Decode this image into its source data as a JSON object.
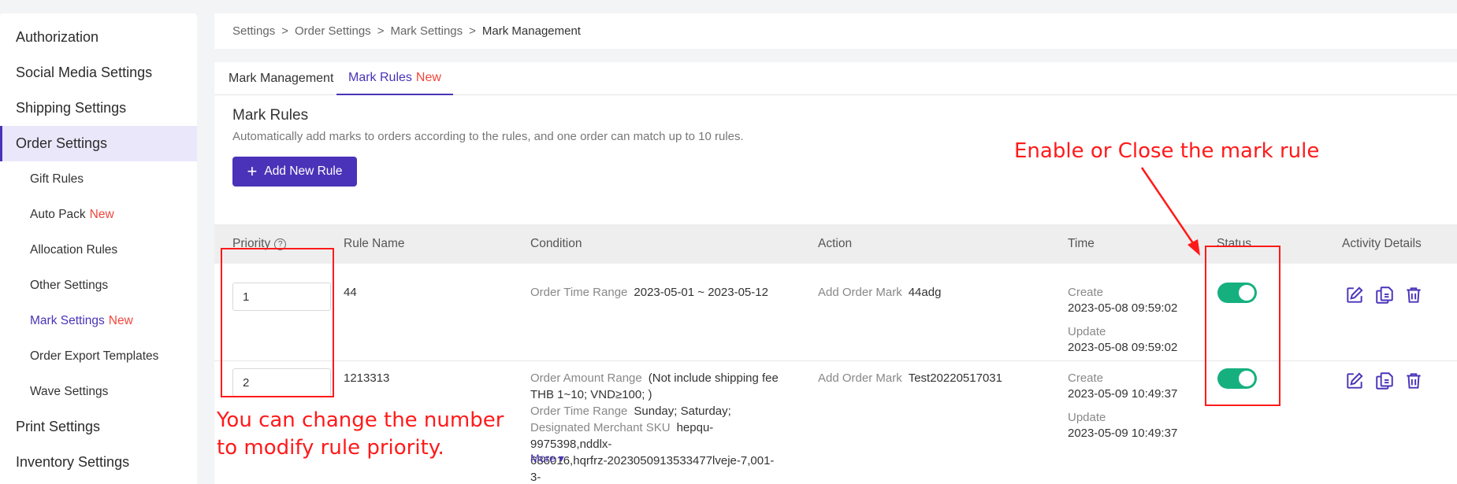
{
  "sidebar": {
    "items": [
      {
        "label": "Authorization"
      },
      {
        "label": "Social Media Settings"
      },
      {
        "label": "Shipping Settings"
      },
      {
        "label": "Order Settings"
      },
      {
        "label": "Gift Rules"
      },
      {
        "label": "Auto Pack",
        "tag": "New"
      },
      {
        "label": "Allocation Rules"
      },
      {
        "label": "Other Settings"
      },
      {
        "label": "Mark Settings",
        "tag": "New"
      },
      {
        "label": "Order Export Templates"
      },
      {
        "label": "Wave Settings"
      },
      {
        "label": "Print Settings"
      },
      {
        "label": "Inventory Settings"
      }
    ]
  },
  "breadcrumb": {
    "items": [
      "Settings",
      "Order Settings",
      "Mark Settings"
    ],
    "current": "Mark Management",
    "separator": ">"
  },
  "tabs": [
    {
      "label": "Mark Management"
    },
    {
      "label": "Mark Rules",
      "tag": "New"
    }
  ],
  "section": {
    "title": "Mark Rules",
    "description": "Automatically add marks to orders according to the rules, and one order can match up to 10 rules.",
    "add_button": "Add New Rule"
  },
  "table": {
    "headers": {
      "priority": "Priority",
      "rule_name": "Rule Name",
      "condition": "Condition",
      "action": "Action",
      "time": "Time",
      "status": "Status",
      "activity": "Activity Details"
    },
    "rows": [
      {
        "priority": "1",
        "rule_name": "44",
        "conditions": [
          {
            "label": "Order Time Range",
            "value": "2023-05-01 ~ 2023-05-12"
          }
        ],
        "action_label": "Add Order Mark",
        "action_value": "44adg",
        "create_label": "Create",
        "create_time": "2023-05-08 09:59:02",
        "update_label": "Update",
        "update_time": "2023-05-08 09:59:02",
        "status_on": true
      },
      {
        "priority": "2",
        "rule_name": "1213313",
        "conditions": [
          {
            "label": "Order Amount Range",
            "value": "(Not include shipping fee"
          },
          {
            "label": "",
            "value": "THB 1~10;  VND≥100; )"
          },
          {
            "label": "Order Time Range",
            "value": "Sunday; Saturday;"
          },
          {
            "label": "Designated Merchant SKU",
            "value": "hepqu-9975398,nddlx-"
          },
          {
            "label": "",
            "value": "686016,hqrfrz-2023050913533477lveje-7,001-3-"
          }
        ],
        "more_label": "More",
        "action_label": "Add Order Mark",
        "action_value": "Test20220517031",
        "create_label": "Create",
        "create_time": "2023-05-09 10:49:37",
        "update_label": "Update",
        "update_time": "2023-05-09 10:49:37",
        "status_on": true
      }
    ]
  },
  "annotations": {
    "status_note": "Enable or Close the mark rule",
    "priority_note_line1": "You can change the number",
    "priority_note_line2": "to modify rule priority.",
    "color": "#ff1a1a"
  },
  "colors": {
    "accent": "#4a33b8",
    "toggle_on": "#16b07e",
    "new_tag": "#f0463c"
  }
}
